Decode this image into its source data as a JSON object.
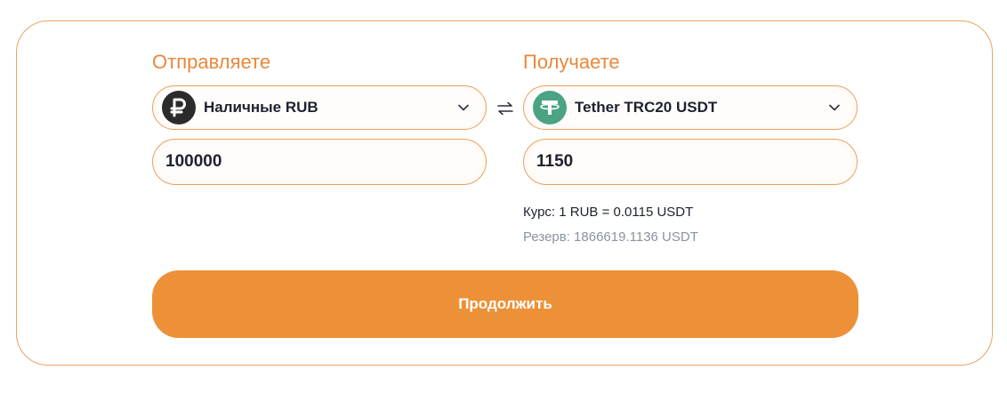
{
  "send": {
    "title": "Отправляете",
    "currency_label": "Наличные RUB",
    "currency_icon": "ruble-icon",
    "amount": "100000"
  },
  "receive": {
    "title": "Получаете",
    "currency_label": "Tether TRC20 USDT",
    "currency_icon": "tether-icon",
    "amount": "1150"
  },
  "rate_text": "Курс: 1 RUB = 0.0115 USDT",
  "reserve_text": "Резерв: 1866619.1136 USDT",
  "continue_label": "Продолжить",
  "colors": {
    "accent": "#ec9138",
    "label": "#e9883a",
    "tether": "#4aa383",
    "ruble_bg": "#2b2b2b"
  }
}
